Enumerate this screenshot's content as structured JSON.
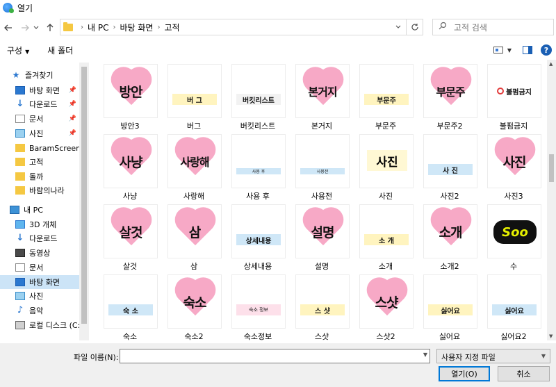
{
  "window": {
    "title": "열기"
  },
  "nav": {
    "back_icon": "arrow-left-icon",
    "forward_icon": "arrow-right-icon",
    "recent_icon": "chevron-down-icon",
    "up_icon": "arrow-up-icon",
    "breadcrumb": [
      "내 PC",
      "바탕 화면",
      "고적"
    ],
    "search_placeholder": "고적 검색"
  },
  "toolbar": {
    "organize_label": "구성",
    "new_folder_label": "새 폴더"
  },
  "sidebar": {
    "quick_access": "즐겨찾기",
    "items": [
      {
        "label": "바탕 화면",
        "icon": "desktop-icon",
        "pinned": true
      },
      {
        "label": "다운로드",
        "icon": "download-icon",
        "pinned": true
      },
      {
        "label": "문서",
        "icon": "document-icon",
        "pinned": true
      },
      {
        "label": "사진",
        "icon": "pictures-icon",
        "pinned": true
      },
      {
        "label": "BaramScreenSho",
        "icon": "folder-icon",
        "pinned": false
      },
      {
        "label": "고적",
        "icon": "folder-icon",
        "pinned": false
      },
      {
        "label": "돌까",
        "icon": "folder-icon",
        "pinned": false
      },
      {
        "label": "바람의나라",
        "icon": "folder-icon",
        "pinned": false
      }
    ],
    "this_pc": "내 PC",
    "pc_items": [
      {
        "label": "3D 개체",
        "icon": "3d-objects-icon"
      },
      {
        "label": "다운로드",
        "icon": "download-icon"
      },
      {
        "label": "동영상",
        "icon": "video-icon"
      },
      {
        "label": "문서",
        "icon": "document-icon"
      },
      {
        "label": "바탕 화면",
        "icon": "desktop-icon",
        "selected": true
      },
      {
        "label": "사진",
        "icon": "pictures-icon"
      },
      {
        "label": "음악",
        "icon": "music-icon"
      },
      {
        "label": "로컬 디스크 (C:)",
        "icon": "disk-icon"
      }
    ]
  },
  "files": [
    {
      "name": "방안3",
      "style": "heart",
      "text": "방안"
    },
    {
      "name": "버그",
      "style": "strip-y",
      "text": "버 그"
    },
    {
      "name": "버킷리스트",
      "style": "strip-w",
      "text": "버킷리스트"
    },
    {
      "name": "본거지",
      "style": "heart",
      "text": "본거지"
    },
    {
      "name": "부문주",
      "style": "strip-y",
      "text": "부문주"
    },
    {
      "name": "부문주2",
      "style": "heart",
      "text": "부문주"
    },
    {
      "name": "불펌금지",
      "style": "forbid",
      "text": "불펌금지"
    },
    {
      "name": "사냥",
      "style": "heart",
      "text": "사냥"
    },
    {
      "name": "사랑해",
      "style": "heart",
      "text": "사랑해"
    },
    {
      "name": "사용 후",
      "style": "strip-b-small",
      "text": "사용 후"
    },
    {
      "name": "사용전",
      "style": "strip-b-small",
      "text": "사용전"
    },
    {
      "name": "사진",
      "style": "big-w",
      "text": "사진"
    },
    {
      "name": "사진2",
      "style": "strip-b",
      "text": "사 진"
    },
    {
      "name": "사진3",
      "style": "heart",
      "text": "사진"
    },
    {
      "name": "살것",
      "style": "heart",
      "text": "살것"
    },
    {
      "name": "삼",
      "style": "heart",
      "text": "삼"
    },
    {
      "name": "상세내용",
      "style": "strip-b",
      "text": "상세내용"
    },
    {
      "name": "설명",
      "style": "heart",
      "text": "설명"
    },
    {
      "name": "소개",
      "style": "strip-y",
      "text": "소 개"
    },
    {
      "name": "소개2",
      "style": "heart",
      "text": "소개"
    },
    {
      "name": "수",
      "style": "soo",
      "text": "Soo"
    },
    {
      "name": "숙소",
      "style": "strip-b",
      "text": "숙 소"
    },
    {
      "name": "숙소2",
      "style": "heart",
      "text": "숙소"
    },
    {
      "name": "숙소정보",
      "style": "strip-p",
      "text": "숙소 정보"
    },
    {
      "name": "스샷",
      "style": "strip-y",
      "text": "스 샷"
    },
    {
      "name": "스샷2",
      "style": "heart",
      "text": "스샷"
    },
    {
      "name": "싫어요",
      "style": "strip-y",
      "text": "싫어요"
    },
    {
      "name": "싫어요2",
      "style": "strip-b",
      "text": "싫어요"
    }
  ],
  "footer": {
    "filename_label": "파일 이름(N):",
    "filename_value": "",
    "filetype": "사용자 지정 파일",
    "open_label": "열기(O)",
    "cancel_label": "취소"
  }
}
